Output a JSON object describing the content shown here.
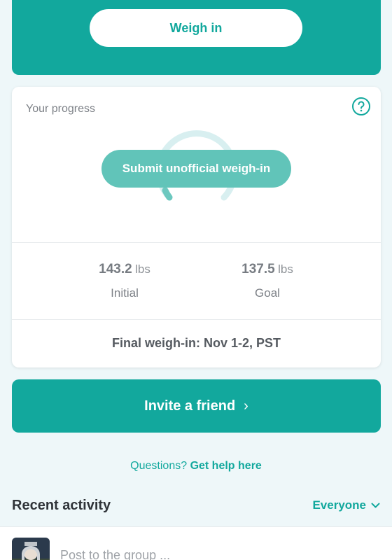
{
  "hero": {
    "weigh_in_label": "Weigh in"
  },
  "progress": {
    "title": "Your progress",
    "submit_unofficial_label": "Submit unofficial weigh-in",
    "initial": {
      "value": "143.2",
      "unit": "lbs",
      "label": "Initial"
    },
    "goal": {
      "value": "137.5",
      "unit": "lbs",
      "label": "Goal"
    },
    "final_weigh_in": "Final weigh-in: Nov 1-2, PST"
  },
  "invite": {
    "label": "Invite a friend",
    "chevron": "›"
  },
  "help": {
    "question": "Questions?",
    "link": "Get help here"
  },
  "recent": {
    "title": "Recent activity",
    "filter": "Everyone"
  },
  "post": {
    "placeholder": "Post to the group ..."
  },
  "colors": {
    "brand": "#12a89d",
    "brand_light": "#61c4b9",
    "background": "#eef7f9"
  },
  "icons": [
    "help-icon",
    "chevron-right-icon",
    "chevron-down-icon",
    "avatar"
  ]
}
